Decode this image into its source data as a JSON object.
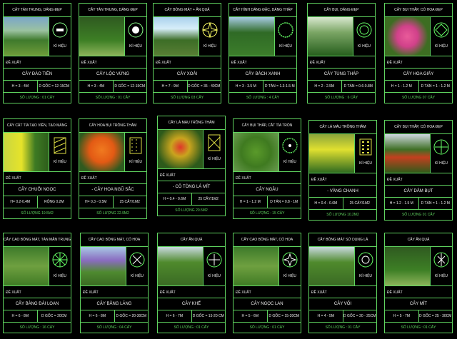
{
  "labels": {
    "kihieu": "KÍ HIỆU",
    "dexuat": "ĐỀ XUẤT"
  },
  "cards": [
    {
      "title": "CÂY TÁN TRUNG, DÁNG ĐẸP",
      "name": "CÂY ĐÀO TIÊN",
      "spec1": "H = 3 - 4M",
      "spec2": "D GỐC = 12-15CM",
      "qty": "SỐ LƯỢNG : 01 CÂY"
    },
    {
      "title": "CÂY TÁN TRUNG, DÁNG ĐẸP",
      "name": "CÂY LỘC VỪNG",
      "spec1": "H = 3 - 4M",
      "spec2": "D GỐC = 12-15CM",
      "qty": "SỐ LƯỢNG : 01 CÂY"
    },
    {
      "title": "CÂY BÓNG MÁT + ĂN QUẢ",
      "name": "CÂY XOÀI",
      "spec1": "H = 7 - 9M",
      "spec2": "D GỐC = 35 - 40CM",
      "qty": "SỐ LƯỢNG 03 CÂY"
    },
    {
      "title": "CÂY HÌNH DÁNG ĐẶC, DÁNG THÁP",
      "name": "CÂY BÁCH XANH",
      "spec1": "H = 3 - 3.5 M",
      "spec2": "D TÁN = 1.3-1.5 M",
      "qty": "SỐ LƯỢNG : 4 CÂY"
    },
    {
      "title": "CÂY BỤI, DÁNG ĐẸP",
      "name": "CÂY TÙNG THÁP",
      "spec1": "H = 2 - 2.5M",
      "spec2": "D TÁN = 0.6-0.8M",
      "qty": "SỐ LƯỢNG : 6 CÂY"
    },
    {
      "title": "CÂY BỤI THẤP, CÓ HOA ĐẸP",
      "name": "CÂY HOA GIẤY",
      "spec1": "H = 1 - 1.2 M",
      "spec2": "D TÁN = 1 - 1.2 M",
      "qty": "SỐ LƯỢNG 07 CÂY"
    },
    {
      "title": "CÂY CẮT TỈA TẠO VIỀN, TẠO MẢNG",
      "name": "CÂY CHUỖI NGỌC",
      "spec1": "H= 0.2-0.4M",
      "spec2": "RỘNG 0.2M",
      "qty": "SỐ LƯỢNG 19.5M2"
    },
    {
      "title": "CÂY HOA BỤI TRỒNG THẢM",
      "name": "- CÂY HOA NGŨ SẮC",
      "spec1": "H= 0.3 - 0.5M",
      "spec2": "25 CÂY/1M2",
      "qty": "SỐ LƯỢNG 22.9M2"
    },
    {
      "title": "CÂY LÁ MÀU TRỒNG THẢM",
      "name": "- CÔ TÒNG LÁ MÍT",
      "spec1": "H = 0.4 - 0.6M",
      "spec2": "25 CÂY/1M2",
      "qty": "SỐ LƯỢNG 20.5M2"
    },
    {
      "title": "CÂY BỤI THẤP, CẮT TỈA TRÒN",
      "name": "CÂY NGÂU",
      "spec1": "H = 1 - 1.2 M",
      "spec2": "D TÁN = 0.8 - 1M",
      "qty": "SỐ LƯỢNG : 15 CÂY"
    },
    {
      "title": "CÂY LÁ MÀU TRỒNG THẢM",
      "name": "- VÀNG CHANH",
      "spec1": "H = 0.4 - 0.6M",
      "spec2": "25 CÂY/1M2",
      "qty": "SỐ LƯỢNG 10.2M2"
    },
    {
      "title": "CÂY BỤI THẤP, CÓ HOA ĐẸP",
      "name": "CÂY DÂM BỤT",
      "spec1": "H = 1.2 - 1.5 M",
      "spec2": "D TÁN = 1 - 1.2 M",
      "qty": "SỐ LƯỢNG 01 CÂY"
    },
    {
      "title": "CÂY CAO BÓNG MÁT, TÁN MẶN TRUNG",
      "name": "CÂY BÀNG ĐÀI LOAN",
      "spec1": "H = 6 - 8M",
      "spec2": "D GỐC = 20CM",
      "qty": "SỐ LƯỢNG : 16 CÂY"
    },
    {
      "title": "CÂY CAO BÓNG MÁT, CÓ HOA",
      "name": "CÂY BẰNG LĂNG",
      "spec1": "H = 6 - 8M",
      "spec2": "D GỐC = 20-30CM",
      "qty": "SỐ LƯỢNG : 04 CÂY"
    },
    {
      "title": "CÂY ĂN QUẢ",
      "name": "CÂY KHẾ",
      "spec1": "H = 6 - 7M",
      "spec2": "D GỐC = 15-20 CM",
      "qty": "SỐ LƯỢNG : 01 CÂY"
    },
    {
      "title": "CÂY CAO BÓNG MÁT, CÓ HOA",
      "name": "CÂY NGỌC LAN",
      "spec1": "H = 5 - 6M",
      "spec2": "D GỐC = 15-20CM",
      "qty": "SỐ LƯỢNG : 01 CÂY"
    },
    {
      "title": "CÂY BÓNG MÁT SỬ DỤNG LÁ",
      "name": "CÂY VỐI",
      "spec1": "H = 4 - 5M",
      "spec2": "D GỐC = 20 - 25CM",
      "qty": "SỐ LƯỢNG : 01 CÂY"
    },
    {
      "title": "CÂY ĂN QUẢ",
      "name": "CÂY MÍT",
      "spec1": "H = 5 - 7M",
      "spec2": "D GỐC = 25 - 30CM",
      "qty": "SỐ LƯỢNG : 01 CÂY"
    }
  ]
}
